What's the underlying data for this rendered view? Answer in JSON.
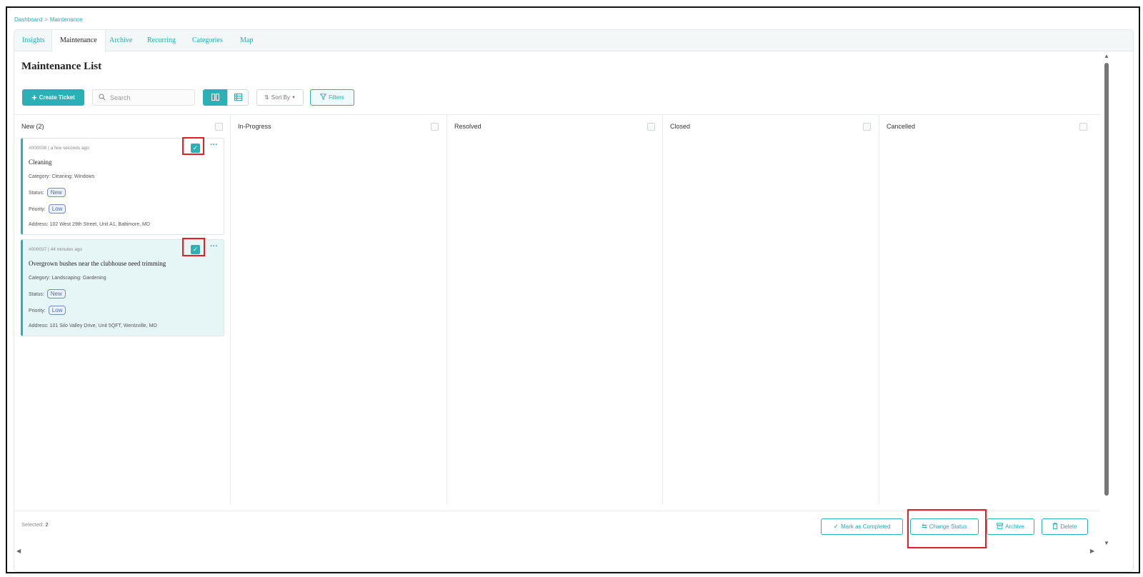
{
  "breadcrumb": {
    "root": "Dashboard",
    "separator": ">",
    "current": "Maintenance"
  },
  "tabs": [
    {
      "label": "Insights",
      "active": false
    },
    {
      "label": "Maintenance",
      "active": true
    },
    {
      "label": "Archive",
      "active": false
    },
    {
      "label": "Recurring",
      "active": false
    },
    {
      "label": "Categories",
      "active": false
    },
    {
      "label": "Map",
      "active": false
    }
  ],
  "page": {
    "title": "Maintenance List"
  },
  "toolbar": {
    "create_label": "Create Ticket",
    "search_placeholder": "Search",
    "sort_label": "Sort By",
    "filters_label": "Filters"
  },
  "columns": [
    {
      "title": "New (2)"
    },
    {
      "title": "In-Progress"
    },
    {
      "title": "Resolved"
    },
    {
      "title": "Closed"
    },
    {
      "title": "Cancelled"
    }
  ],
  "cards": [
    {
      "meta": "#000038 | a few seconds ago",
      "title": "Cleaning",
      "category_label": "Category:",
      "category": "Cleaning: Windows",
      "status_label": "Status:",
      "status": "New",
      "priority_label": "Priority:",
      "priority": "Low",
      "address_label": "Address:",
      "address": "102 West 29th Street, Unit A1, Baltimore, MD",
      "checked": true
    },
    {
      "meta": "#000037 | 44 minutes ago",
      "title": "Overgrown bushes near the clubhouse need trimming",
      "category_label": "Category:",
      "category": "Landscaping: Gardening",
      "status_label": "Status:",
      "status": "New",
      "priority_label": "Priority:",
      "priority": "Low",
      "address_label": "Address:",
      "address": "101 Silo Valley Drive, Unit 5QFT, Wentzville, MO",
      "checked": true
    }
  ],
  "footer": {
    "selected_label": "Selected:",
    "selected_count": "2",
    "mark_completed": "Mark as Completed",
    "change_status": "Change Status",
    "archive": "Archive",
    "delete": "Delete"
  },
  "colors": {
    "accent": "#2ab0b5",
    "highlight_box": "#e21f26",
    "pill": "#4a6ea8"
  },
  "icons": [
    "plus-icon",
    "search-icon",
    "board-view-icon",
    "table-view-icon",
    "sort-icon",
    "filter-icon",
    "check-icon",
    "more-icon",
    "swap-icon",
    "archive-icon",
    "trash-icon"
  ]
}
